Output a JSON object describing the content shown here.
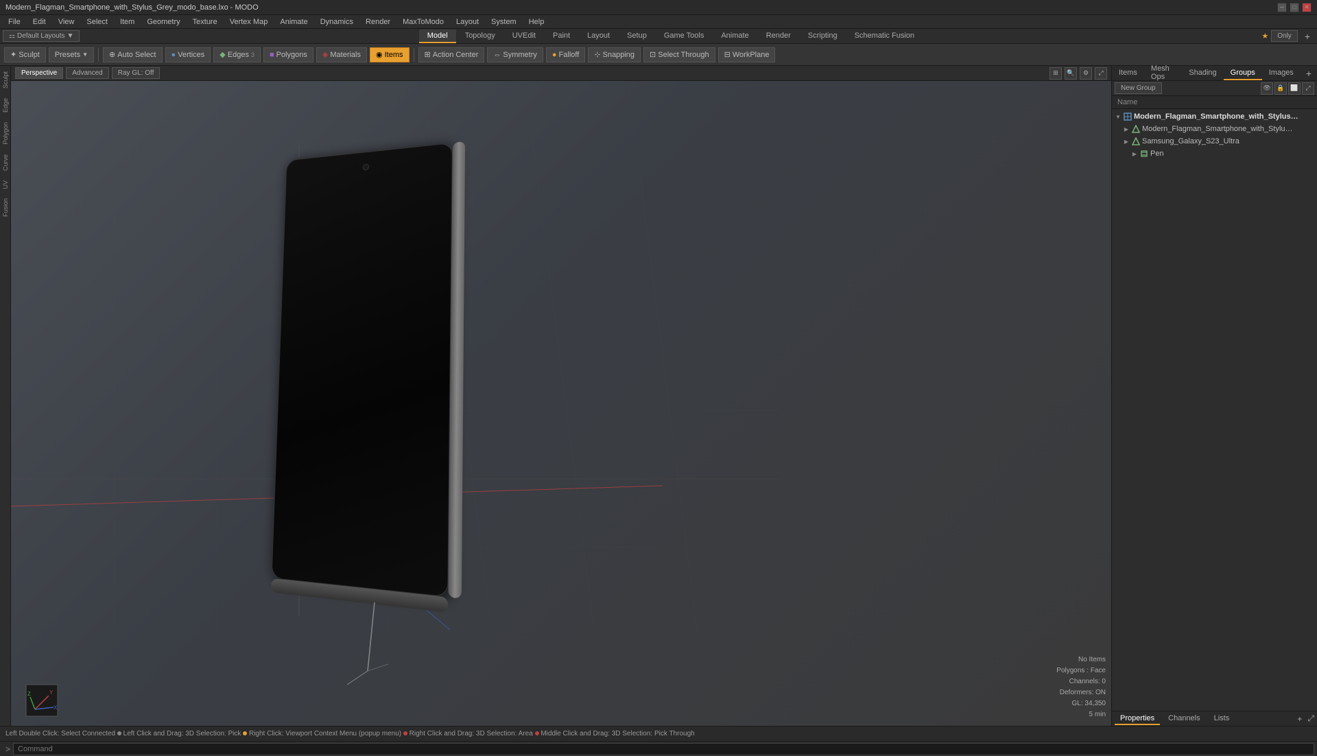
{
  "titleBar": {
    "title": "Modern_Flagman_Smartphone_with_Stylus_Grey_modo_base.lxo - MODO",
    "controls": [
      "minimize",
      "maximize",
      "close"
    ]
  },
  "menuBar": {
    "items": [
      "File",
      "Edit",
      "View",
      "Select",
      "Item",
      "Geometry",
      "Texture",
      "Vertex Map",
      "Animate",
      "Dynamics",
      "Render",
      "MaxToModo",
      "Layout",
      "System",
      "Help"
    ]
  },
  "layoutBar": {
    "layoutLabel": "Default Layouts",
    "tabs": [
      "Model",
      "Topology",
      "UVEdit",
      "Paint",
      "Layout",
      "Setup",
      "Game Tools",
      "Animate",
      "Render",
      "Scripting",
      "Schematic Fusion"
    ],
    "activeTab": "Model",
    "addTabLabel": "+",
    "onlyLabel": "Only",
    "starLabel": "★"
  },
  "toolbar": {
    "sculptBtn": "Sculpt",
    "presetsBtn": "Presets",
    "autoSelectBtn": "Auto Select",
    "verticesBtn": "Vertices",
    "edgesBtn": "Edges",
    "edgesCount": "3",
    "polygonsBtn": "Polygons",
    "materialsBtn": "Materials",
    "itemsBtn": "Items",
    "actionCenterBtn": "Action Center",
    "symmetryBtn": "Symmetry",
    "falloffBtn": "Falloff",
    "snappingBtn": "Snapping",
    "selectThroughBtn": "Select Through",
    "workPlaneBtn": "WorkPlane"
  },
  "viewport": {
    "header": {
      "perspectiveBtn": "Perspective",
      "advancedBtn": "Advanced",
      "rayGLBtn": "Ray GL: Off"
    }
  },
  "sceneInfo": {
    "noItems": "No Items",
    "polygons": "Polygons : Face",
    "channels": "Channels: 0",
    "deformers": "Deformers: ON",
    "gl": "GL: 34,350",
    "time": "5 min"
  },
  "rightPanel": {
    "tabs": [
      "Items",
      "Mesh Ops",
      "Shading",
      "Groups",
      "Images"
    ],
    "activeTab": "Groups",
    "newGroupBtn": "New Group",
    "nameHeader": "Name",
    "treeItems": [
      {
        "label": "Modern_Flagman_Smartphone_with_Stylus_...",
        "level": 0,
        "type": "root",
        "expanded": true
      },
      {
        "label": "Modern_Flagman_Smartphone_with_Stylus_Grey",
        "level": 1,
        "type": "mesh",
        "expanded": false
      },
      {
        "label": "Samsung_Galaxy_S23_Ultra",
        "level": 1,
        "type": "mesh",
        "expanded": false
      },
      {
        "label": "Pen",
        "level": 2,
        "type": "layer",
        "expanded": false
      }
    ]
  },
  "bottomPanel": {
    "tabs": [
      "Properties",
      "Channels",
      "Lists"
    ],
    "activeTab": "Properties",
    "addBtn": "+"
  },
  "statusBar": {
    "message": "Left Double Click: Select Connected ● Left Click and Drag: 3D Selection: Pick ● Right Click: Viewport Context Menu (popup menu) ● Right Click and Drag: 3D Selection: Area ● Middle Click and Drag: 3D Selection: Pick Through",
    "dots": [
      "gray",
      "orange",
      "red",
      "red",
      "orange"
    ]
  },
  "commandBar": {
    "arrow": ">",
    "placeholder": "Command",
    "label": "Command"
  }
}
